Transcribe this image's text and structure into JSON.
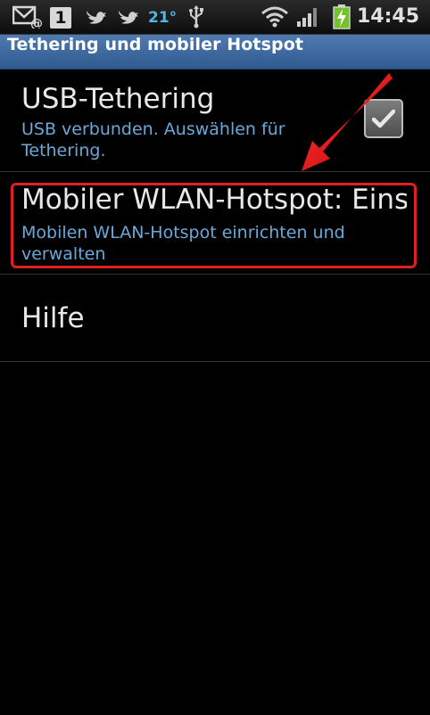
{
  "status_bar": {
    "badge_number": "1",
    "temperature": "21°",
    "time": "14:45",
    "icons": [
      "mail-icon",
      "calendar-icon",
      "twitter-icon",
      "twitter-icon",
      "usb-icon",
      "wifi-icon",
      "signal-icon",
      "battery-charging-icon"
    ]
  },
  "title_bar": {
    "title": "Tethering und mobiler Hotspot",
    "color": "#3d6aa3"
  },
  "preferences": [
    {
      "title": "USB-Tethering",
      "summary": "USB verbunden. Auswählen für Tethering.",
      "checked": true
    },
    {
      "title": "Mobiler WLAN-Hotspot: Einst",
      "summary": "Mobilen WLAN-Hotspot einrichten und verwalten",
      "highlighted": true
    },
    {
      "title": "Hilfe"
    }
  ],
  "colors": {
    "summary_text": "#6aa8d8",
    "highlight": "#e02020",
    "background": "#000000"
  }
}
